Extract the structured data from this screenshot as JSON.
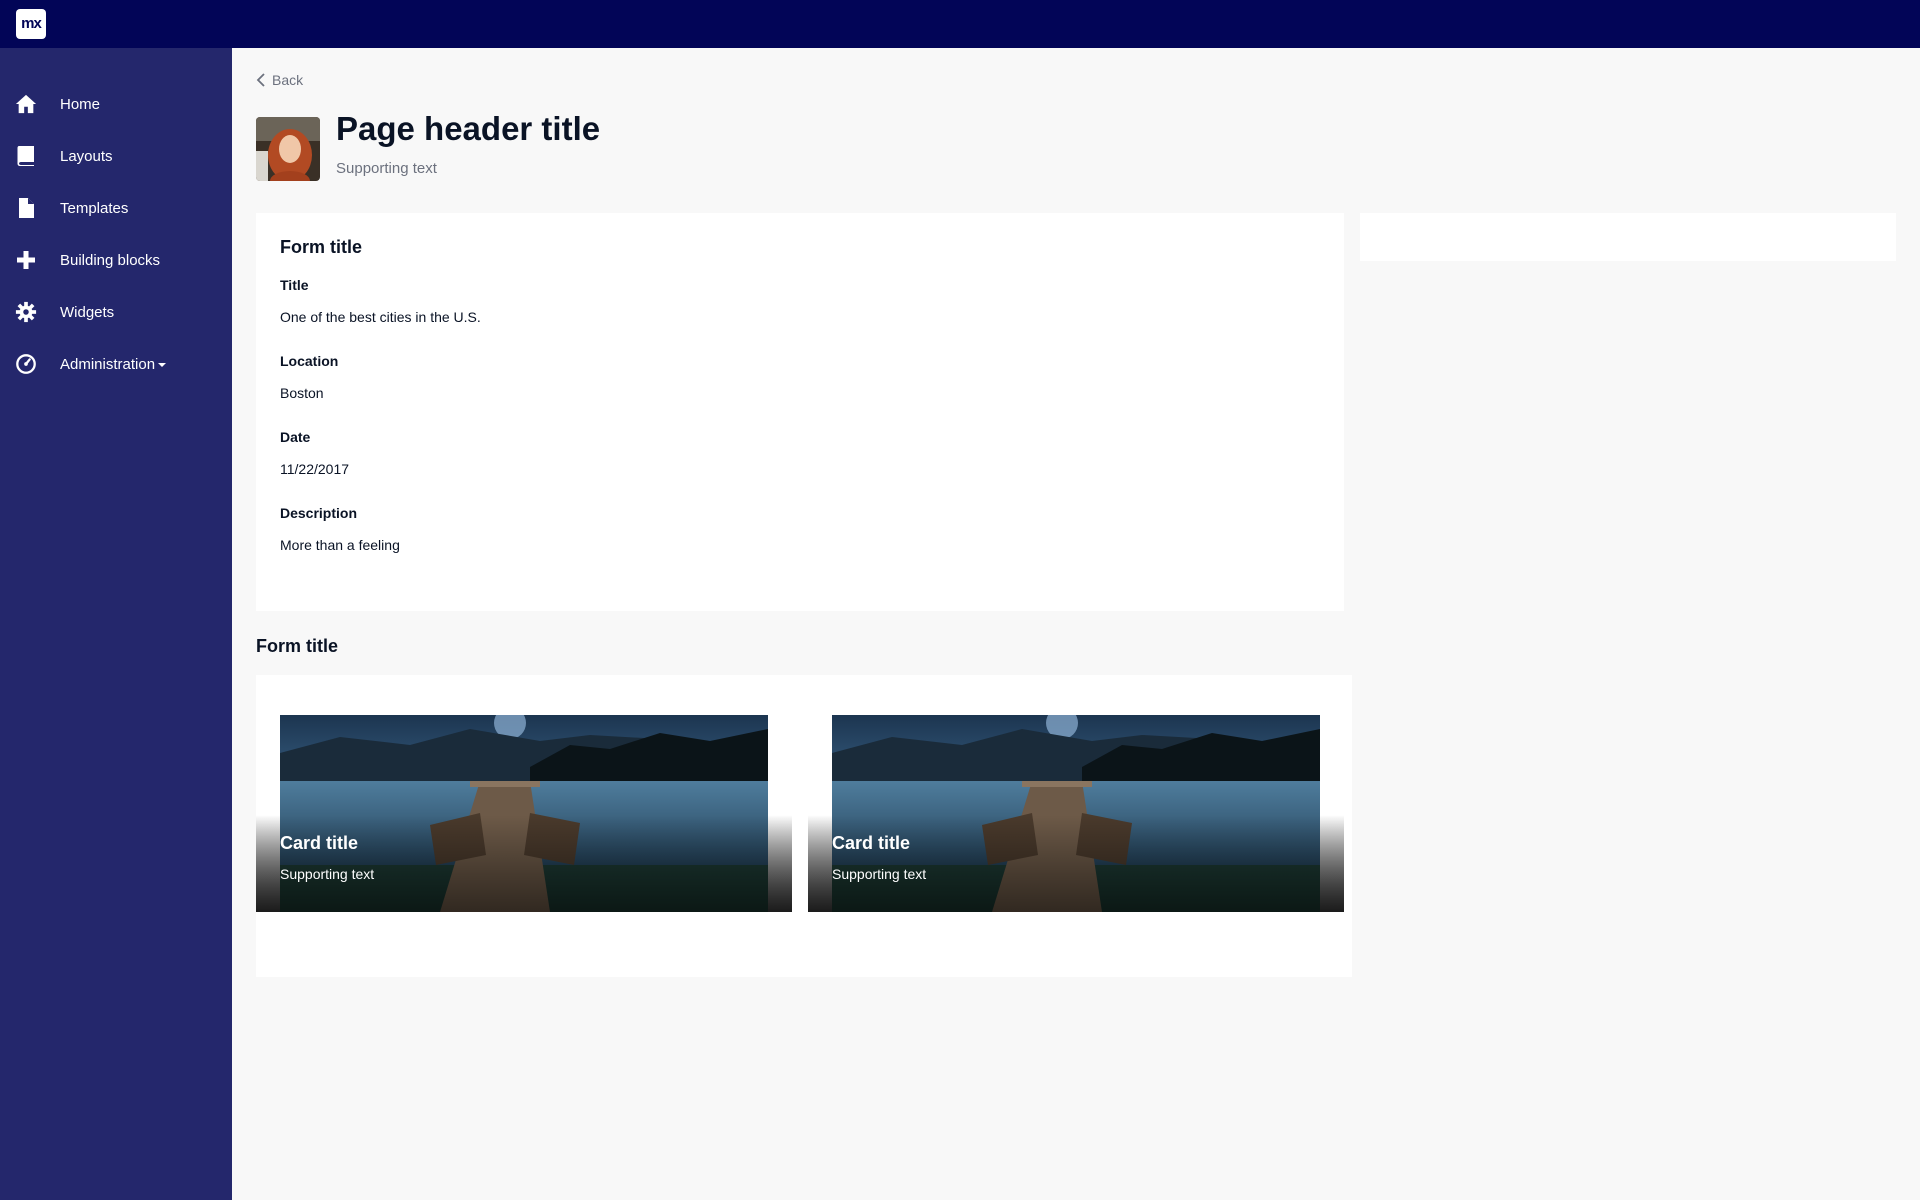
{
  "app": {
    "logo_text": "mx"
  },
  "sidebar": {
    "items": [
      {
        "label": "Home",
        "icon": "home-icon"
      },
      {
        "label": "Layouts",
        "icon": "book-icon"
      },
      {
        "label": "Templates",
        "icon": "file-icon"
      },
      {
        "label": "Building blocks",
        "icon": "plus-icon"
      },
      {
        "label": "Widgets",
        "icon": "gear-icon"
      },
      {
        "label": "Administration",
        "icon": "dashboard-icon",
        "has_dropdown": true
      }
    ]
  },
  "header": {
    "back_label": "Back",
    "title": "Page header title",
    "subtitle": "Supporting text"
  },
  "form": {
    "title": "Form title",
    "fields": [
      {
        "label": "Title",
        "value": "One of the best cities in the U.S."
      },
      {
        "label": "Location",
        "value": "Boston"
      },
      {
        "label": "Date",
        "value": "11/22/2017"
      },
      {
        "label": "Description",
        "value": "More than a feeling"
      }
    ]
  },
  "cards_section": {
    "title": "Form title",
    "cards": [
      {
        "title": "Card title",
        "subtitle": "Supporting text"
      },
      {
        "title": "Card title",
        "subtitle": "Supporting text"
      }
    ]
  },
  "colors": {
    "topbar": "#020557",
    "sidebar": "#24276c",
    "background": "#f8f8f8"
  }
}
